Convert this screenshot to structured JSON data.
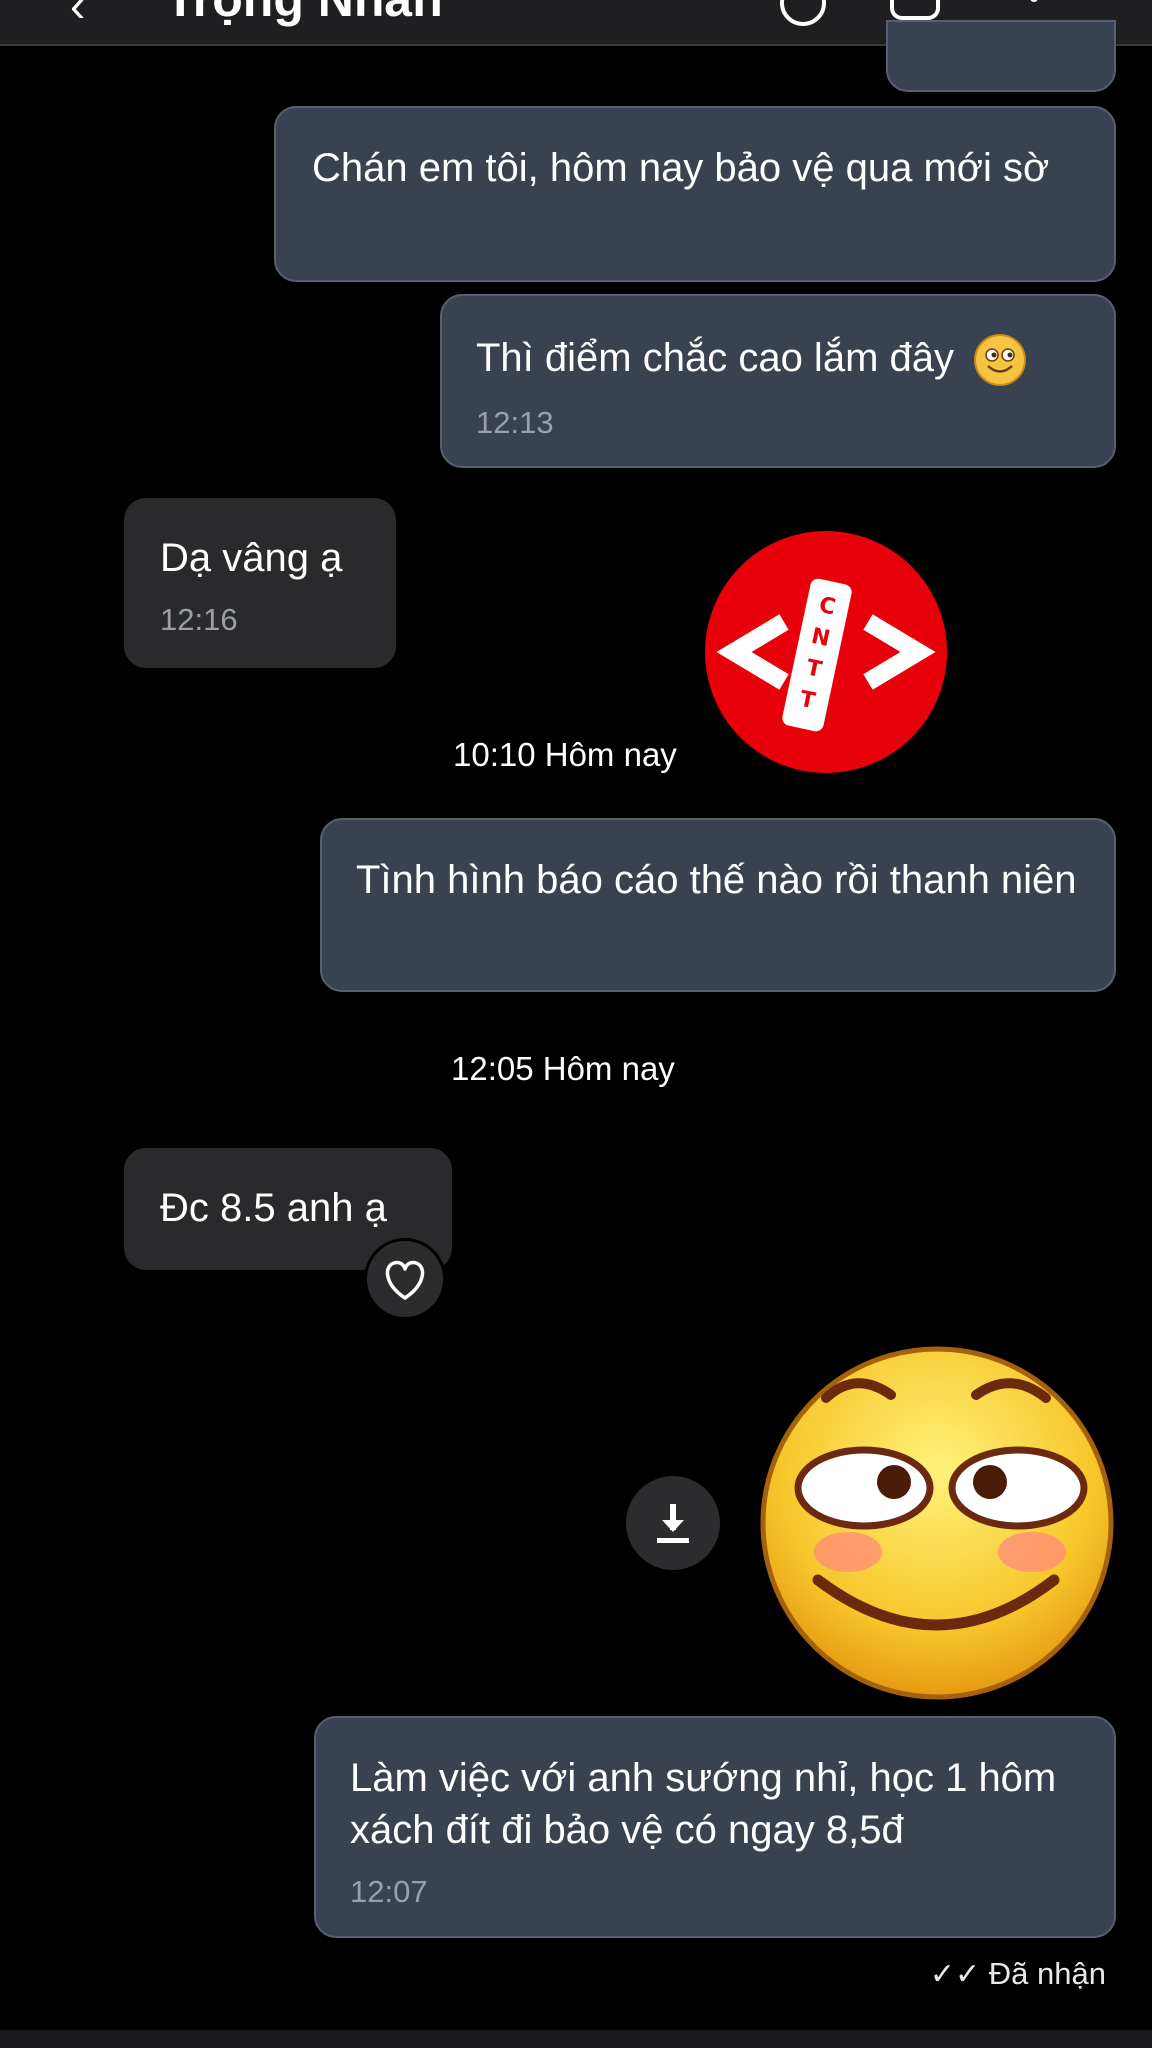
{
  "header": {
    "back_icon": "chevron-left-icon",
    "contact_name": "Trọng Nhân",
    "icons": [
      "phone-icon",
      "video-icon",
      "menu-icon"
    ]
  },
  "messages": {
    "m1": {
      "text": "Chán em tôi, hôm nay bảo vệ qua mới sờ"
    },
    "m2": {
      "text": "Thì điểm chắc cao lắm đây",
      "emoji": "smiling-face-icon",
      "time": "12:13"
    },
    "m3": {
      "text": "Dạ vâng ạ",
      "time": "12:16"
    },
    "sticker_logo": {
      "letters": [
        "C",
        "N",
        "T",
        "T"
      ],
      "color": "#e8000b"
    },
    "sep1": "10:10 Hôm nay",
    "m4": {
      "text": "Tình hình báo cáo thế nào rồi thanh niên"
    },
    "sep2": "12:05 Hôm nay",
    "m5": {
      "text": "Đc 8.5 anh ạ",
      "reaction_icon": "heart-icon"
    },
    "sticker_smile": {
      "download_icon": "download-icon"
    },
    "m6": {
      "text": "Làm việc với anh sướng nhỉ, học 1 hôm xách đít đi bảo vệ có ngay 8,5đ",
      "time": "12:07"
    }
  },
  "status": {
    "icon": "double-check-icon",
    "text": "Đã nhận"
  },
  "colors": {
    "outgoing_bubble": "#3a4150",
    "incoming_bubble": "#2a2a2c",
    "background": "#000000"
  }
}
